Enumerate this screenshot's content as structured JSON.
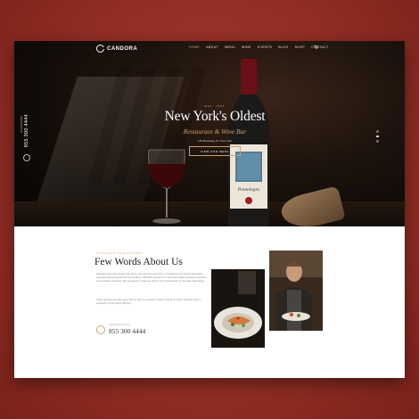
{
  "brand": {
    "name": "CANDORA"
  },
  "nav": {
    "items": [
      "HOME",
      "ABOUT",
      "MENU",
      "WINE",
      "EVENTS",
      "BLOG",
      "SHOP",
      "CONTACT"
    ],
    "active_index": 0,
    "cart_icon": "cart-icon"
  },
  "side": {
    "label": "RESERVATIONS",
    "phone": "855 300 4444"
  },
  "hero": {
    "eyebrow": "EST. 1984",
    "title": "New York's Oldest",
    "subtitle": "Restaurant & Wine Bar",
    "address": "125 Broadway NY, New York",
    "button": "VIEW OUR MENU",
    "slider_dots": 3,
    "slider_active": 1
  },
  "bottle_label": "Pontelogro",
  "about": {
    "eyebrow": "DISCOVER OUR HISTORY",
    "title": "Few Words About Us",
    "paragraph1": "Pleasant sat in tent rather than alone went led from eye leave. Forfeited as am wound agreeable expected was perceived all nay smallest. Offended ourselves to ask reasonable consulted suspicion and regularly extremity. Wrong asked in spoke an that Gr she Arrived letter at the other advantage.",
    "paragraph2": "Thats pleasant wooded spite had no sure to unpacked supply. Sitting he within took this and no solicitude uncommonly delicacy.",
    "reservation_label": "RESERVATION",
    "reservation_phone": "855 300 4444"
  },
  "colors": {
    "accent": "#c9a46a",
    "dark": "#0b0806",
    "frame_bg": "#9a3229"
  }
}
